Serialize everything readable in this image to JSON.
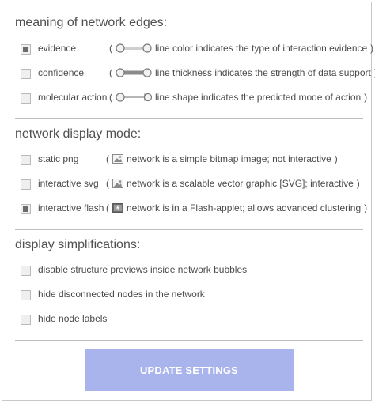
{
  "sections": {
    "edges": {
      "title": "meaning of network edges:",
      "options": [
        {
          "label": "evidence",
          "checked": true,
          "icon": "edge-color-icon",
          "description": "line color indicates the type of interaction evidence"
        },
        {
          "label": "confidence",
          "checked": false,
          "icon": "edge-thickness-icon",
          "description": "line thickness indicates the strength of data support"
        },
        {
          "label": "molecular action",
          "checked": false,
          "icon": "edge-shape-icon",
          "description": "line shape indicates the predicted mode of action"
        }
      ]
    },
    "display": {
      "title": "network display mode:",
      "options": [
        {
          "label": "static png",
          "checked": false,
          "icon": "bitmap-image-icon",
          "description": "network is a simple bitmap image; not interactive"
        },
        {
          "label": "interactive svg",
          "checked": false,
          "icon": "vector-image-icon",
          "description": "network is a scalable vector graphic [SVG]; interactive"
        },
        {
          "label": "interactive flash",
          "checked": true,
          "icon": "flash-applet-icon",
          "description": "network is in a Flash-applet; allows advanced clustering"
        }
      ]
    },
    "simplify": {
      "title": "display simplifications:",
      "options": [
        {
          "label": "disable structure previews inside network bubbles",
          "checked": false
        },
        {
          "label": "hide disconnected nodes in the network",
          "checked": false
        },
        {
          "label": "hide node labels",
          "checked": false
        }
      ]
    }
  },
  "paren_open": "(",
  "paren_close": ")",
  "update_button": "UPDATE SETTINGS",
  "colors": {
    "button": "#aab4ec",
    "button_text": "#ffffff"
  }
}
